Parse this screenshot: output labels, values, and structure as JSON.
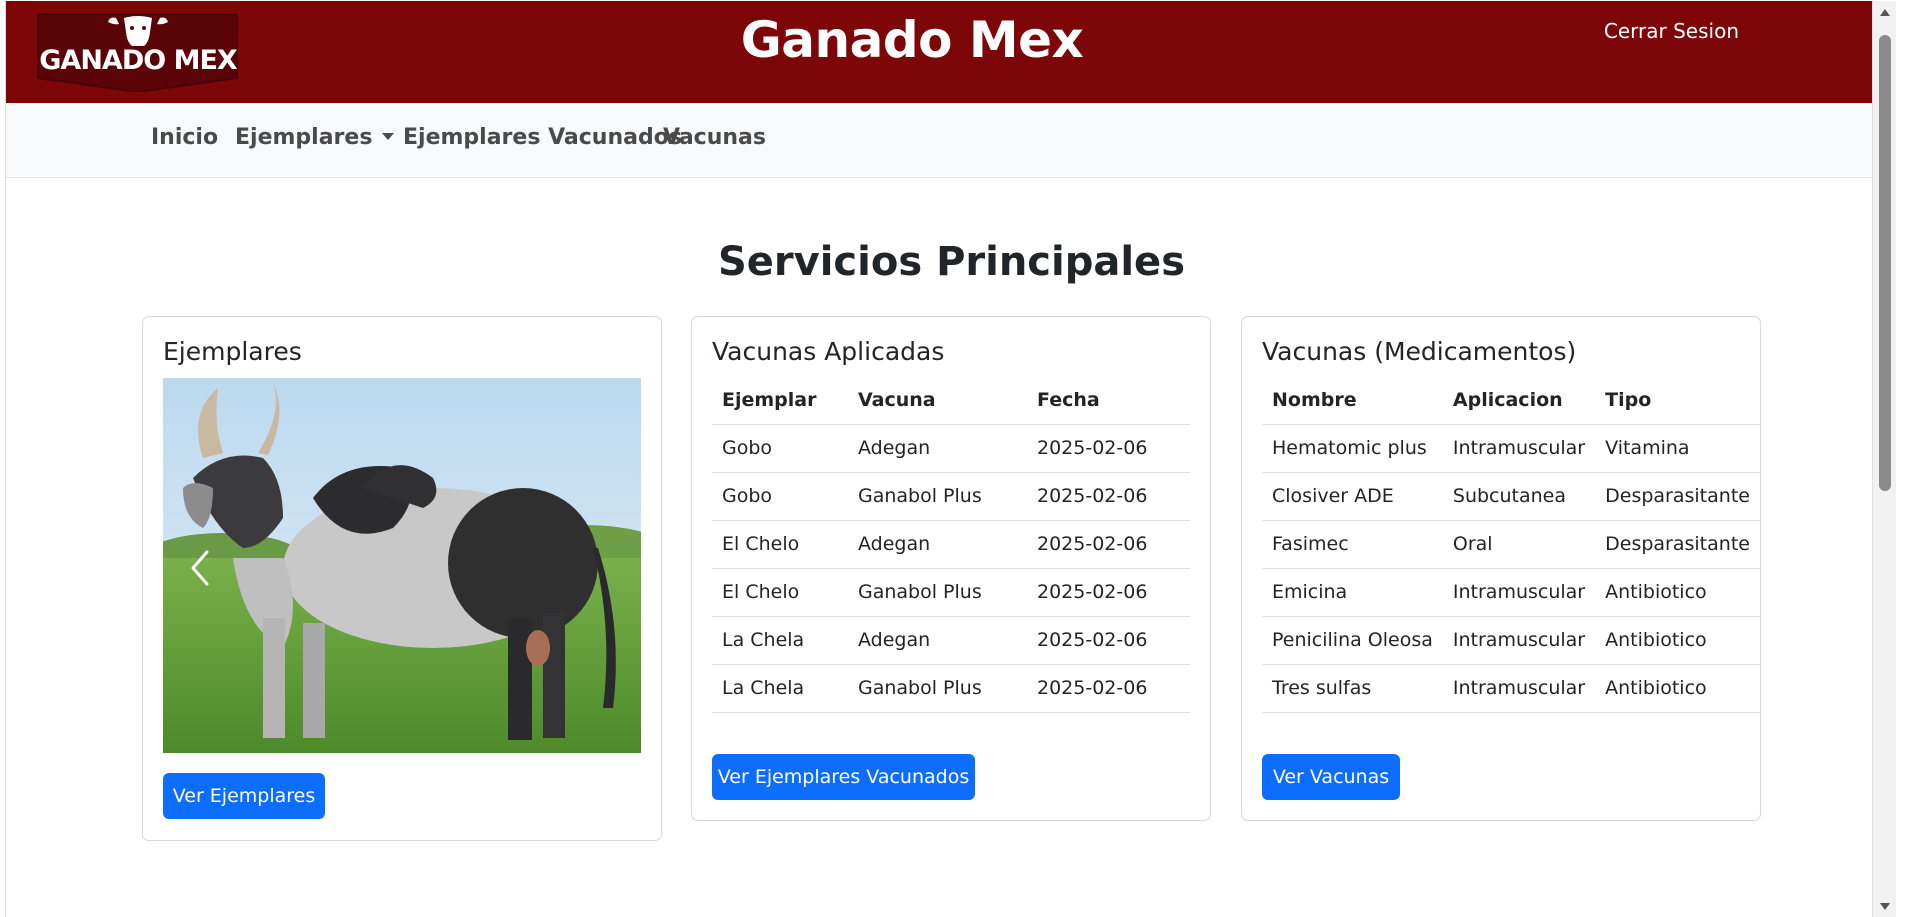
{
  "header": {
    "logo_text": "GANADO MEX",
    "site_title": "Ganado Mex",
    "logout_label": "Cerrar Sesion",
    "background_color": "#7d0609"
  },
  "nav": {
    "items": [
      {
        "label": "Inicio"
      },
      {
        "label": "Ejemplares"
      },
      {
        "label": "Ejemplares Vacunados"
      },
      {
        "label": "Vacunas"
      }
    ]
  },
  "main": {
    "section_title": "Servicios Principales"
  },
  "cards": {
    "ejemplares": {
      "title": "Ejemplares",
      "button_label": "Ver Ejemplares"
    },
    "vacunas_aplicadas": {
      "title": "Vacunas Aplicadas",
      "columns": [
        "Ejemplar",
        "Vacuna",
        "Fecha"
      ],
      "rows": [
        [
          "Gobo",
          "Adegan",
          "2025-02-06"
        ],
        [
          "Gobo",
          "Ganabol Plus",
          "2025-02-06"
        ],
        [
          "El Chelo",
          "Adegan",
          "2025-02-06"
        ],
        [
          "El Chelo",
          "Ganabol Plus",
          "2025-02-06"
        ],
        [
          "La Chela",
          "Adegan",
          "2025-02-06"
        ],
        [
          "La Chela",
          "Ganabol Plus",
          "2025-02-06"
        ]
      ],
      "button_label": "Ver Ejemplares Vacunados"
    },
    "vacunas_medicamentos": {
      "title": "Vacunas (Medicamentos)",
      "columns": [
        "Nombre",
        "Aplicacion",
        "Tipo"
      ],
      "rows": [
        [
          "Hematomic plus",
          "Intramuscular",
          "Vitamina"
        ],
        [
          "Closiver ADE",
          "Subcutanea",
          "Desparasitante"
        ],
        [
          "Fasimec",
          "Oral",
          "Desparasitante"
        ],
        [
          "Emicina",
          "Intramuscular",
          "Antibiotico"
        ],
        [
          "Penicilina Oleosa",
          "Intramuscular",
          "Antibiotico"
        ],
        [
          "Tres sulfas",
          "Intramuscular",
          "Antibiotico"
        ]
      ],
      "button_label": "Ver Vacunas"
    }
  },
  "colors": {
    "primary_button": "#0d6efd",
    "navbar_bg": "#f8f9fa"
  }
}
